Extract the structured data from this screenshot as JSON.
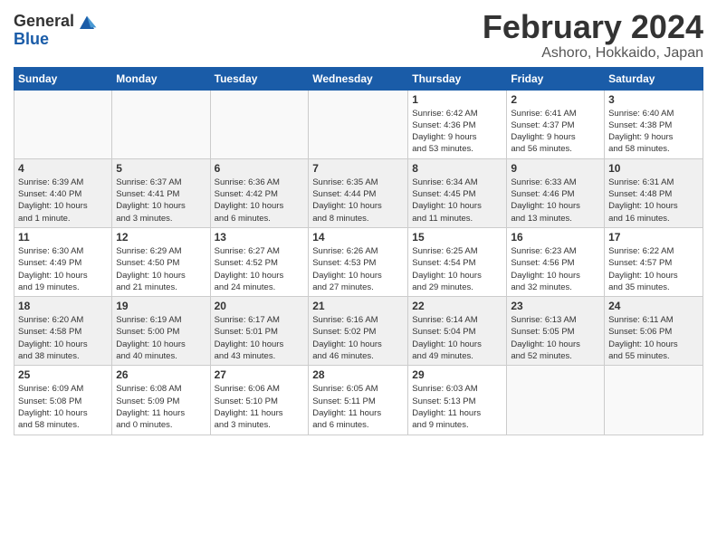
{
  "logo": {
    "line1": "General",
    "line2": "Blue"
  },
  "title": "February 2024",
  "subtitle": "Ashoro, Hokkaido, Japan",
  "days_of_week": [
    "Sunday",
    "Monday",
    "Tuesday",
    "Wednesday",
    "Thursday",
    "Friday",
    "Saturday"
  ],
  "weeks": [
    [
      {
        "day": "",
        "info": ""
      },
      {
        "day": "",
        "info": ""
      },
      {
        "day": "",
        "info": ""
      },
      {
        "day": "",
        "info": ""
      },
      {
        "day": "1",
        "info": "Sunrise: 6:42 AM\nSunset: 4:36 PM\nDaylight: 9 hours\nand 53 minutes."
      },
      {
        "day": "2",
        "info": "Sunrise: 6:41 AM\nSunset: 4:37 PM\nDaylight: 9 hours\nand 56 minutes."
      },
      {
        "day": "3",
        "info": "Sunrise: 6:40 AM\nSunset: 4:38 PM\nDaylight: 9 hours\nand 58 minutes."
      }
    ],
    [
      {
        "day": "4",
        "info": "Sunrise: 6:39 AM\nSunset: 4:40 PM\nDaylight: 10 hours\nand 1 minute."
      },
      {
        "day": "5",
        "info": "Sunrise: 6:37 AM\nSunset: 4:41 PM\nDaylight: 10 hours\nand 3 minutes."
      },
      {
        "day": "6",
        "info": "Sunrise: 6:36 AM\nSunset: 4:42 PM\nDaylight: 10 hours\nand 6 minutes."
      },
      {
        "day": "7",
        "info": "Sunrise: 6:35 AM\nSunset: 4:44 PM\nDaylight: 10 hours\nand 8 minutes."
      },
      {
        "day": "8",
        "info": "Sunrise: 6:34 AM\nSunset: 4:45 PM\nDaylight: 10 hours\nand 11 minutes."
      },
      {
        "day": "9",
        "info": "Sunrise: 6:33 AM\nSunset: 4:46 PM\nDaylight: 10 hours\nand 13 minutes."
      },
      {
        "day": "10",
        "info": "Sunrise: 6:31 AM\nSunset: 4:48 PM\nDaylight: 10 hours\nand 16 minutes."
      }
    ],
    [
      {
        "day": "11",
        "info": "Sunrise: 6:30 AM\nSunset: 4:49 PM\nDaylight: 10 hours\nand 19 minutes."
      },
      {
        "day": "12",
        "info": "Sunrise: 6:29 AM\nSunset: 4:50 PM\nDaylight: 10 hours\nand 21 minutes."
      },
      {
        "day": "13",
        "info": "Sunrise: 6:27 AM\nSunset: 4:52 PM\nDaylight: 10 hours\nand 24 minutes."
      },
      {
        "day": "14",
        "info": "Sunrise: 6:26 AM\nSunset: 4:53 PM\nDaylight: 10 hours\nand 27 minutes."
      },
      {
        "day": "15",
        "info": "Sunrise: 6:25 AM\nSunset: 4:54 PM\nDaylight: 10 hours\nand 29 minutes."
      },
      {
        "day": "16",
        "info": "Sunrise: 6:23 AM\nSunset: 4:56 PM\nDaylight: 10 hours\nand 32 minutes."
      },
      {
        "day": "17",
        "info": "Sunrise: 6:22 AM\nSunset: 4:57 PM\nDaylight: 10 hours\nand 35 minutes."
      }
    ],
    [
      {
        "day": "18",
        "info": "Sunrise: 6:20 AM\nSunset: 4:58 PM\nDaylight: 10 hours\nand 38 minutes."
      },
      {
        "day": "19",
        "info": "Sunrise: 6:19 AM\nSunset: 5:00 PM\nDaylight: 10 hours\nand 40 minutes."
      },
      {
        "day": "20",
        "info": "Sunrise: 6:17 AM\nSunset: 5:01 PM\nDaylight: 10 hours\nand 43 minutes."
      },
      {
        "day": "21",
        "info": "Sunrise: 6:16 AM\nSunset: 5:02 PM\nDaylight: 10 hours\nand 46 minutes."
      },
      {
        "day": "22",
        "info": "Sunrise: 6:14 AM\nSunset: 5:04 PM\nDaylight: 10 hours\nand 49 minutes."
      },
      {
        "day": "23",
        "info": "Sunrise: 6:13 AM\nSunset: 5:05 PM\nDaylight: 10 hours\nand 52 minutes."
      },
      {
        "day": "24",
        "info": "Sunrise: 6:11 AM\nSunset: 5:06 PM\nDaylight: 10 hours\nand 55 minutes."
      }
    ],
    [
      {
        "day": "25",
        "info": "Sunrise: 6:09 AM\nSunset: 5:08 PM\nDaylight: 10 hours\nand 58 minutes."
      },
      {
        "day": "26",
        "info": "Sunrise: 6:08 AM\nSunset: 5:09 PM\nDaylight: 11 hours\nand 0 minutes."
      },
      {
        "day": "27",
        "info": "Sunrise: 6:06 AM\nSunset: 5:10 PM\nDaylight: 11 hours\nand 3 minutes."
      },
      {
        "day": "28",
        "info": "Sunrise: 6:05 AM\nSunset: 5:11 PM\nDaylight: 11 hours\nand 6 minutes."
      },
      {
        "day": "29",
        "info": "Sunrise: 6:03 AM\nSunset: 5:13 PM\nDaylight: 11 hours\nand 9 minutes."
      },
      {
        "day": "",
        "info": ""
      },
      {
        "day": "",
        "info": ""
      }
    ]
  ]
}
